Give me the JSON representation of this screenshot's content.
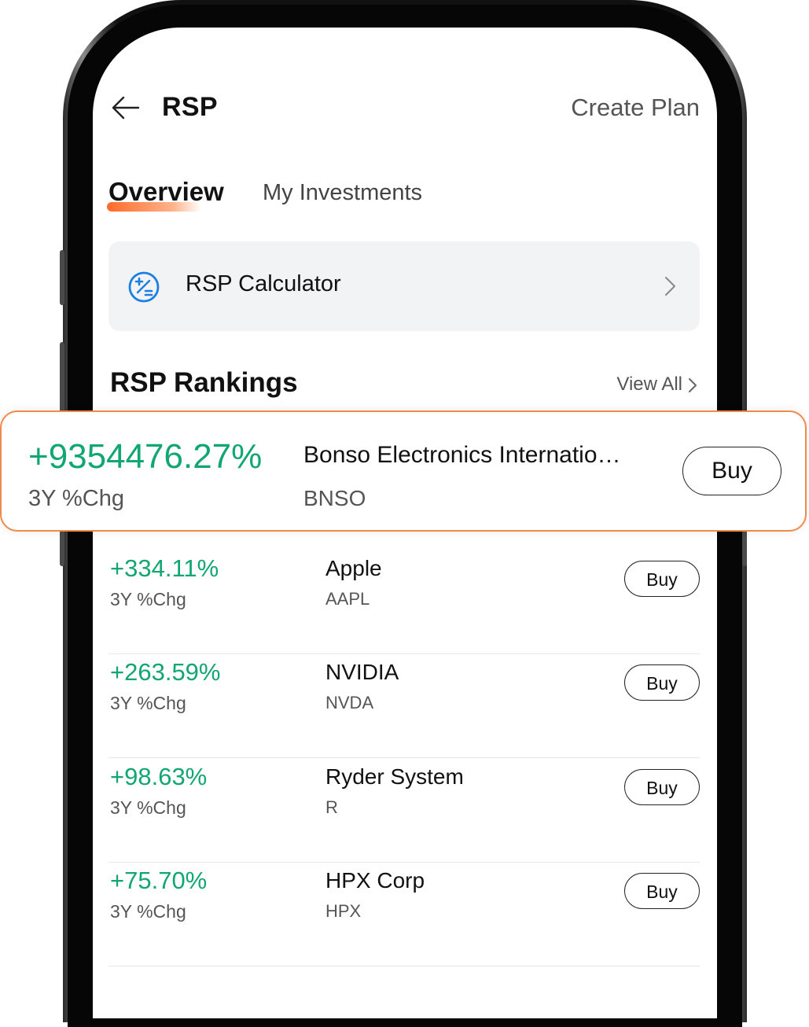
{
  "header": {
    "title": "RSP",
    "action": "Create Plan"
  },
  "tabs": [
    {
      "label": "Overview",
      "active": true
    },
    {
      "label": "My Investments",
      "active": false
    }
  ],
  "calculator": {
    "label": "RSP Calculator",
    "icon": "calculator-plus-minus-icon"
  },
  "rankings": {
    "title": "RSP Rankings",
    "view_all": "View All",
    "metric_label": "3Y %Chg",
    "highlight": {
      "change": "+9354476.27%",
      "name": "Bonso Electronics Internatio…",
      "ticker": "BNSO",
      "buy": "Buy"
    },
    "items": [
      {
        "change": "+334.11%",
        "name": "Apple",
        "ticker": "AAPL",
        "buy": "Buy"
      },
      {
        "change": "+263.59%",
        "name": "NVIDIA",
        "ticker": "NVDA",
        "buy": "Buy"
      },
      {
        "change": "+98.63%",
        "name": "Ryder System",
        "ticker": "R",
        "buy": "Buy"
      },
      {
        "change": "+75.70%",
        "name": "HPX Corp",
        "ticker": "HPX",
        "buy": "Buy"
      }
    ]
  },
  "colors": {
    "positive": "#11a672",
    "highlight_border": "#f08a4b",
    "accent": "#ff6a2a",
    "icon_blue": "#1a7fe0"
  }
}
